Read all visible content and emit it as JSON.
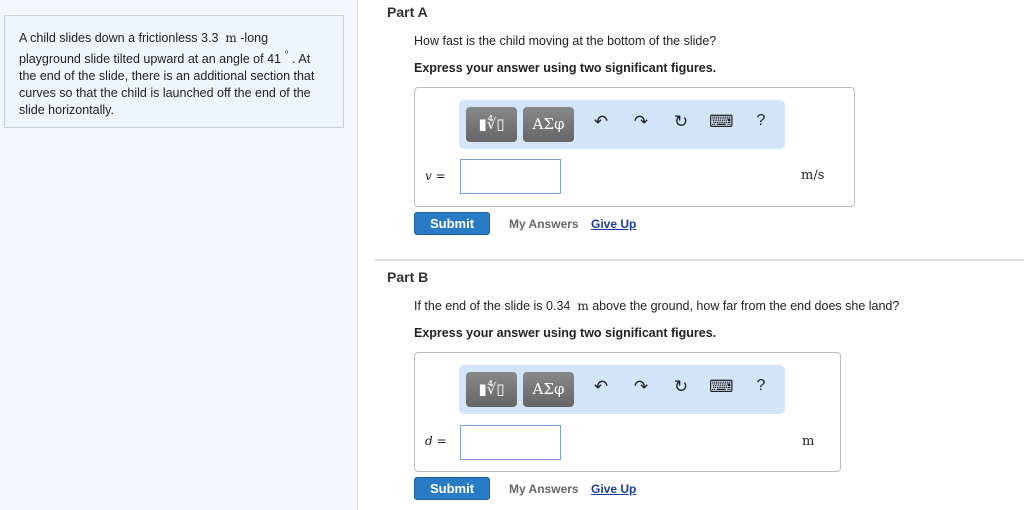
{
  "problem": {
    "text_1": "A child slides down a frictionless 3.3",
    "unit_1": "m",
    "text_2": "-long playground slide tilted upward at an angle of 41",
    "unit_2": "°",
    "text_3": ". At the end of the slide, there is an additional section that curves so that the child is launched off the end of the slide horizontally."
  },
  "toolbar": {
    "templates_label": "▮∜▯",
    "symbols_label": "ΑΣφ",
    "undo": "↶",
    "redo": "↷",
    "reset": "↻",
    "keyboard": "⌨",
    "help": "?"
  },
  "part_a": {
    "title": "Part A",
    "question": "How fast is the child moving at the bottom of the slide?",
    "instruction": "Express your answer using two significant figures.",
    "var_label": "v =",
    "value": "",
    "unit": "m/s",
    "submit": "Submit",
    "my_answers": "My Answers",
    "give_up": "Give Up"
  },
  "part_b": {
    "title": "Part B",
    "question_1": "If the end of the slide is 0.34",
    "question_unit": "m",
    "question_2": "above the ground, how far from the end does she land?",
    "instruction": "Express your answer using two significant figures.",
    "var_label": "d =",
    "value": "",
    "unit": "m",
    "submit": "Submit",
    "my_answers": "My Answers",
    "give_up": "Give Up"
  }
}
